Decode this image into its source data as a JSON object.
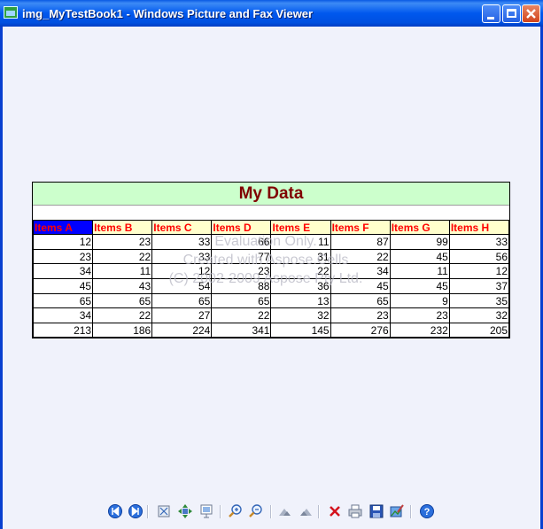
{
  "window": {
    "title": "img_MyTestBook1 - Windows Picture and Fax Viewer"
  },
  "sheet": {
    "title": "My Data",
    "headers": [
      "Items A",
      "Items B",
      "Items C",
      "Items D",
      "Items E",
      "Items F",
      "Items G",
      "Items H"
    ],
    "rows": [
      [
        12,
        23,
        33,
        66,
        11,
        87,
        99,
        33
      ],
      [
        23,
        22,
        33,
        77,
        31,
        22,
        45,
        56
      ],
      [
        34,
        11,
        12,
        23,
        22,
        34,
        11,
        12
      ],
      [
        45,
        43,
        54,
        88,
        36,
        45,
        45,
        37
      ],
      [
        65,
        65,
        65,
        65,
        13,
        65,
        9,
        35
      ],
      [
        34,
        22,
        27,
        22,
        32,
        23,
        23,
        32
      ],
      [
        213,
        186,
        224,
        341,
        145,
        276,
        232,
        205
      ]
    ],
    "watermark": [
      "Evaluation Only.",
      "Created with Aspose.Cells",
      "(C) 2002-2009 Aspose Pty Ltd."
    ],
    "colors": {
      "banner": "#ccffcc",
      "title": "#800000",
      "header_bg": "#ffffcc",
      "header_text": "#ff0000",
      "first_header_bg": "#0000ff"
    }
  },
  "toolbar": {
    "buttons": [
      "previous-image-icon",
      "next-image-icon",
      "best-fit-icon",
      "actual-size-icon",
      "slideshow-icon",
      "zoom-in-icon",
      "zoom-out-icon",
      "rotate-clockwise-icon",
      "rotate-counterclockwise-icon",
      "delete-icon",
      "print-icon",
      "save-icon",
      "edit-icon",
      "help-icon"
    ]
  }
}
